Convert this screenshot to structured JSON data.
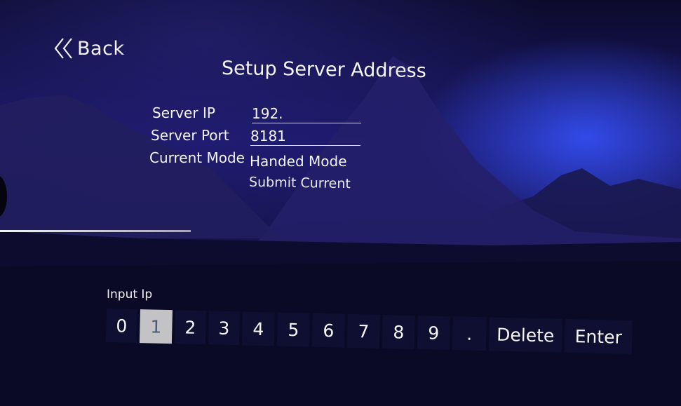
{
  "nav": {
    "back_label": "Back"
  },
  "page": {
    "title": "Setup Server Address"
  },
  "form": {
    "server_ip_label": "Server IP",
    "server_ip_value": "192.",
    "server_port_label": "Server Port",
    "server_port_value": "8181",
    "current_mode_label": "Current Mode",
    "current_mode_value": "Handed Mode",
    "submit_label": "Submit Current"
  },
  "keypad": {
    "label": "Input Ip",
    "keys": [
      "0",
      "1",
      "2",
      "3",
      "4",
      "5",
      "6",
      "7",
      "8",
      "9",
      ".",
      "Delete",
      "Enter"
    ],
    "selected_key": "1"
  },
  "colors": {
    "sky_top": "#0e0c33",
    "sky_mid": "#1e1a66",
    "accent_glow": "#2f4cff",
    "selected_key_bg": "#c3c3c6"
  }
}
